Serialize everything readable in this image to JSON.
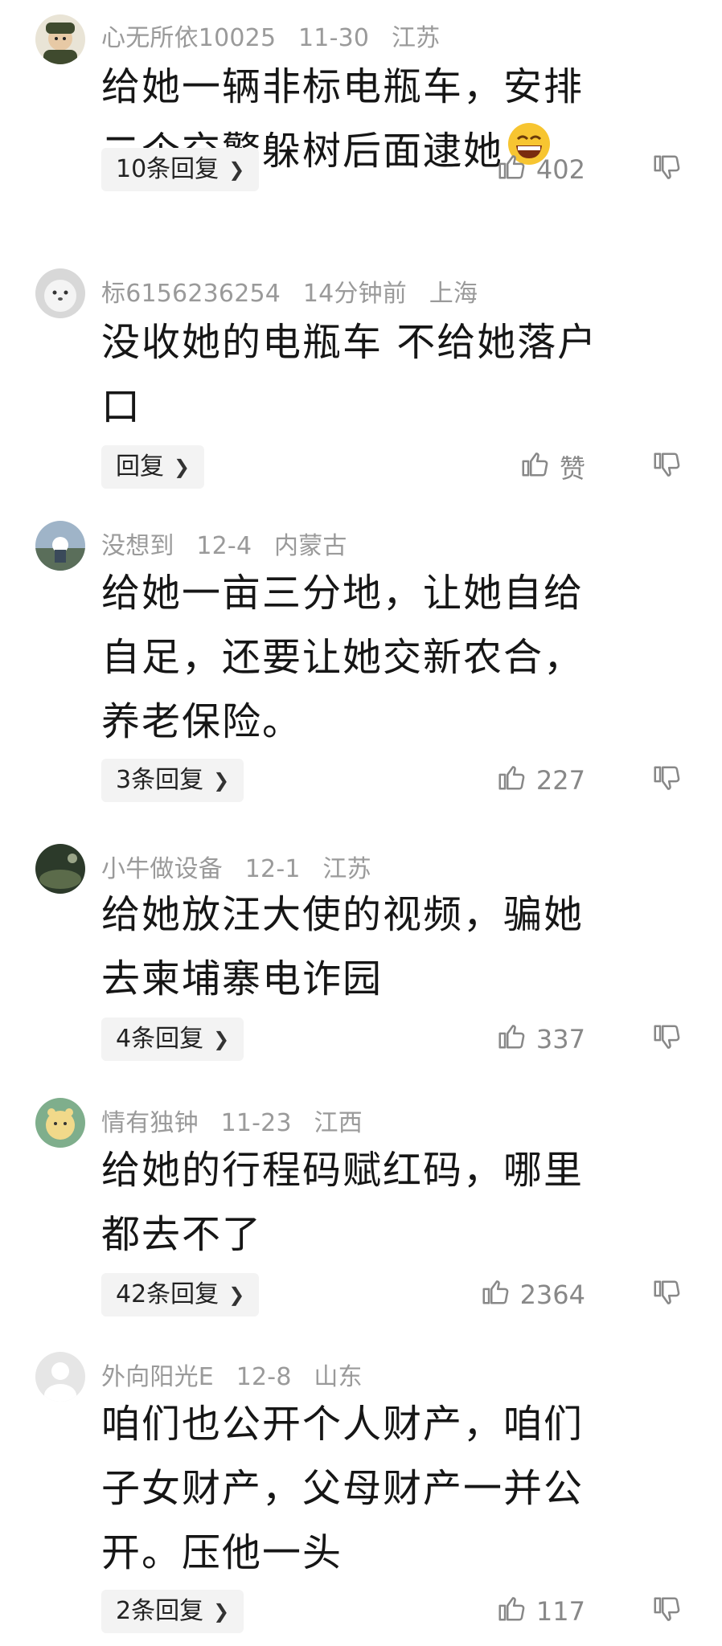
{
  "comments": [
    {
      "user": "心无所依10025",
      "time": "11-30",
      "location": "江苏",
      "lines": [
        "给她一辆非标电瓶车，安排",
        "二个交警躲树后面逮她"
      ],
      "has_emoji": true,
      "emoji": "grinning-emoji",
      "reply_label": "10条回复",
      "likes": "402",
      "avatar_color": "#3f4a2e"
    },
    {
      "user": "标6156236254",
      "time": "14分钟前",
      "location": "上海",
      "lines": [
        "没收她的电瓶车 不给她落户",
        "口"
      ],
      "reply_label": "回复",
      "likes": "赞",
      "avatar_color": "#d8d8d8"
    },
    {
      "user": "没想到",
      "time": "12-4",
      "location": "内蒙古",
      "lines": [
        "给她一亩三分地，让她自给",
        "自足，还要让她交新农合，",
        "养老保险。"
      ],
      "reply_label": "3条回复",
      "likes": "227",
      "avatar_color": "#6b8299"
    },
    {
      "user": "小牛做设备",
      "time": "12-1",
      "location": "江苏",
      "lines": [
        "给她放汪大使的视频，骗她",
        "去柬埔寨电诈园"
      ],
      "reply_label": "4条回复",
      "likes": "337",
      "avatar_color": "#2c3a2a"
    },
    {
      "user": "情有独钟",
      "time": "11-23",
      "location": "江西",
      "lines": [
        "给她的行程码赋红码，哪里",
        "都去不了"
      ],
      "reply_label": "42条回复",
      "likes": "2364",
      "avatar_color": "#7fae8c"
    },
    {
      "user": "外向阳光E",
      "time": "12-8",
      "location": "山东",
      "lines": [
        "咱们也公开个人财产，咱们",
        "子女财产，父母财产一并公",
        "开。压他一头"
      ],
      "reply_label": "2条回复",
      "likes": "117",
      "avatar_color": "#e6e6e6"
    }
  ]
}
